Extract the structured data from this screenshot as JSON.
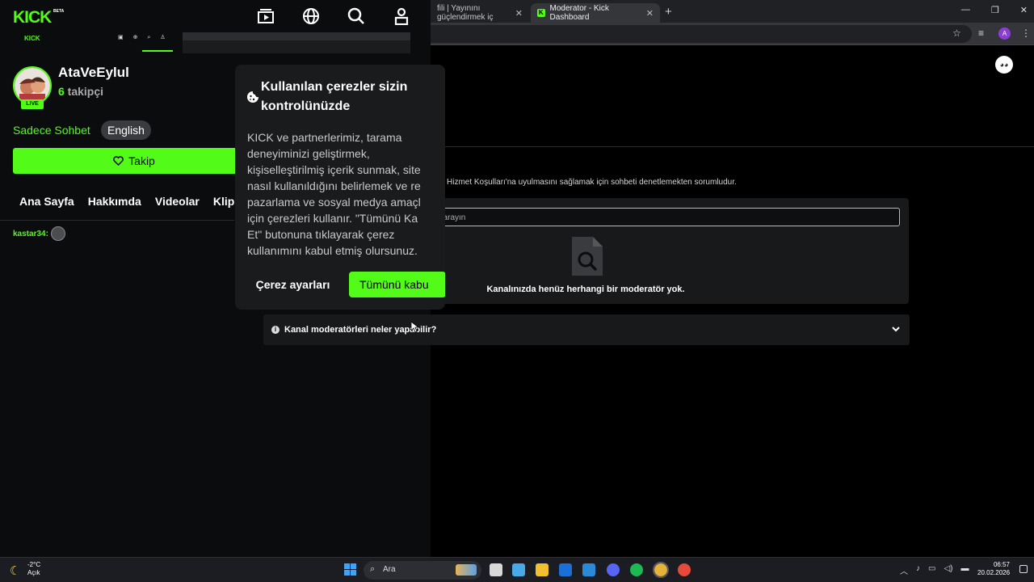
{
  "browser": {
    "tab1_title": "fili | Yayınını güçlendirmek iç",
    "tab2_title": "Moderator - Kick Dashboard",
    "tab_close": "✕",
    "new_tab": "+",
    "window_controls": [
      "—",
      "❐",
      "✕"
    ],
    "profile_initial": "A"
  },
  "dashboard": {
    "mod_description": "orm Hizmet Koşulları'na uyulmasını sağlamak için sohbeti denetlemekten sorumludur.",
    "search_placeholder": "ni arayın",
    "empty_text": "Kanalınızda henüz herhangi bir moderatör yok.",
    "accordion_label": "Kanal moderatörleri neler yapabilir?"
  },
  "kick": {
    "logo": "KICK",
    "beta": "BETA",
    "channel_name": "AtaVeEylul",
    "followers_count": "6",
    "followers_label": " takipçi",
    "live_label": "LIVE",
    "chat_mode": "Sadece Sohbet",
    "language": "English",
    "follow_label": "Takip",
    "nav_tabs": [
      "Ana Sayfa",
      "Hakkımda",
      "Videolar",
      "Klip"
    ],
    "chat_user": "kastar34:",
    "mini_logo": "KICK"
  },
  "cookie": {
    "title": "Kullanılan çerezler sizin kontrolünüzde",
    "body": "KICK ve partnerlerimiz, tarama\ndeneyiminizi geliştirmek,\nkişiselleştirilmiş içerik sunmak, site\nnasıl kullanıldığını belirlemek ve re\npazarlama ve sosyal medya amaçl\niçin çerezleri kullanır. \"Tümünü Ka\nEt\" butonuna tıklayarak çerez\nkullanımını kabul etmiş olursunuz.",
    "settings_label": "Çerez ayarları",
    "accept_label": "Tümünü kabu"
  },
  "taskbar": {
    "weather_temp": "-2°C",
    "weather_desc": "Açık",
    "search_label": "Ara",
    "time": "06:57",
    "date": "20.02.2026"
  },
  "colors": {
    "kick_green": "#53fc18",
    "background": "#0b0c0d",
    "panel": "#18191b"
  }
}
